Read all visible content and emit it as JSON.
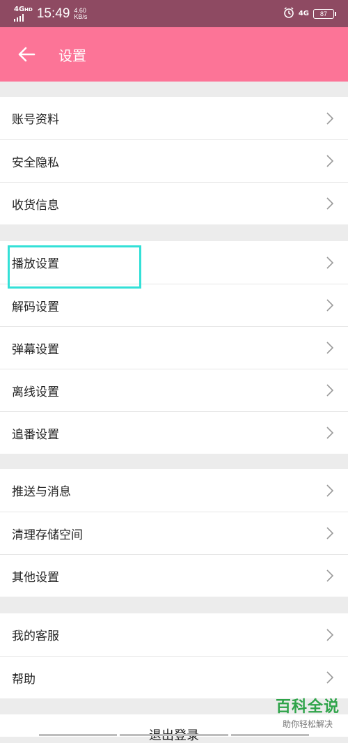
{
  "status_bar": {
    "network_left": "4G",
    "network_sub": "HD",
    "time": "15:49",
    "speed_value": "4.60",
    "speed_unit": "KB/s",
    "network_right": "4G",
    "battery": "87",
    "icons": [
      "signal-icon",
      "alarm-icon",
      "battery-icon"
    ]
  },
  "header": {
    "title": "设置",
    "back_icon": "arrow-left-icon",
    "background": "#fc7497"
  },
  "groups": [
    {
      "items": [
        "账号资料",
        "安全隐私",
        "收货信息"
      ]
    },
    {
      "items": [
        "播放设置",
        "解码设置",
        "弹幕设置",
        "离线设置",
        "追番设置"
      ]
    },
    {
      "items": [
        "推送与消息",
        "清理存储空间",
        "其他设置"
      ]
    },
    {
      "items": [
        "我的客服",
        "帮助"
      ]
    }
  ],
  "highlighted_item": "播放设置",
  "highlight_color": "#33e0d7",
  "logout_label": "退出登录",
  "watermark": {
    "title": "百科全说",
    "subtitle": "助你轻松解决"
  }
}
